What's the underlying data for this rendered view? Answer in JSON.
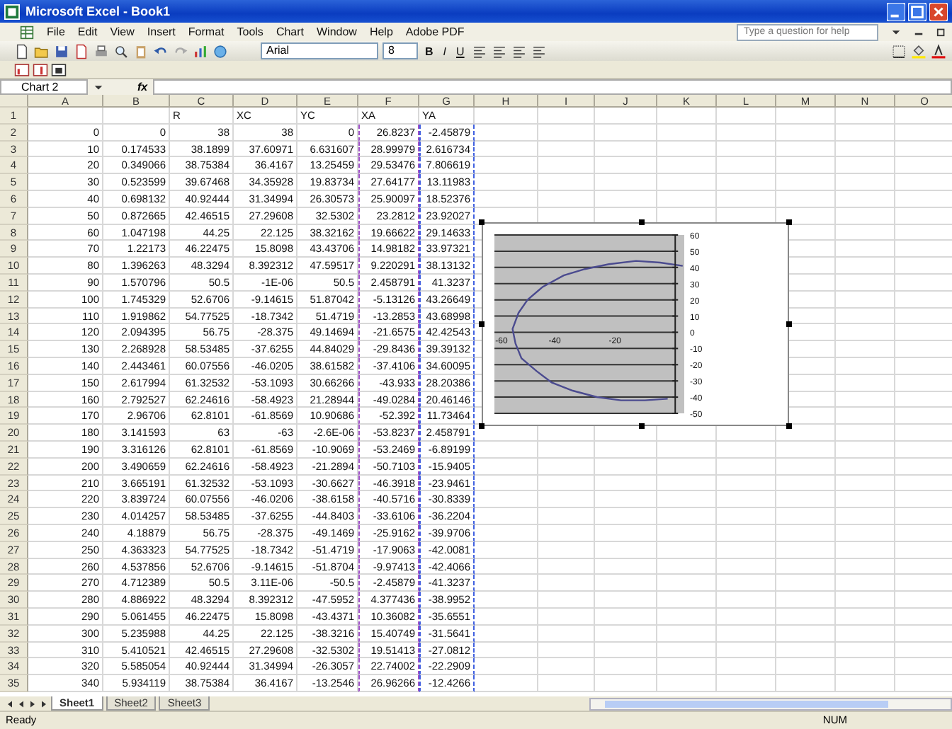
{
  "window": {
    "title": "Microsoft Excel - Book1"
  },
  "menu": [
    "File",
    "Edit",
    "View",
    "Insert",
    "Format",
    "Tools",
    "Chart",
    "Window",
    "Help",
    "Adobe PDF"
  ],
  "help_box": {
    "placeholder": "Type a question for help"
  },
  "format_toolbar": {
    "font": "Arial",
    "size": "8",
    "styles": [
      {
        "label": "B",
        "kind": "bold"
      },
      {
        "label": "I",
        "kind": "italic"
      },
      {
        "label": "U",
        "kind": "underline"
      }
    ]
  },
  "formula_bar": {
    "name_box": "Chart 2",
    "function_label": "fx"
  },
  "columns": [
    "A",
    "B",
    "C",
    "D",
    "E",
    "F",
    "G",
    "H",
    "I",
    "J",
    "K",
    "L",
    "M",
    "N",
    "O"
  ],
  "rows": [
    {
      "number": "1",
      "kind": "labels",
      "cells": [
        null,
        null,
        "R",
        "XC",
        "YC",
        "XA",
        "YA"
      ]
    },
    {
      "number": "2",
      "kind": "values",
      "cells": [
        "0",
        "0",
        "38",
        "38",
        "0",
        "26.8237",
        "-2.45879"
      ]
    },
    {
      "number": "3",
      "kind": "values",
      "cells": [
        "10",
        "0.174533",
        "38.1899",
        "37.60971",
        "6.631607",
        "28.99979",
        "2.616734"
      ]
    },
    {
      "number": "4",
      "kind": "values",
      "cells": [
        "20",
        "0.349066",
        "38.75384",
        "36.4167",
        "13.25459",
        "29.53476",
        "7.806619"
      ]
    },
    {
      "number": "5",
      "kind": "values",
      "cells": [
        "30",
        "0.523599",
        "39.67468",
        "34.35928",
        "19.83734",
        "27.64177",
        "13.11983"
      ]
    },
    {
      "number": "6",
      "kind": "values",
      "cells": [
        "40",
        "0.698132",
        "40.92444",
        "31.34994",
        "26.30573",
        "25.90097",
        "18.52376"
      ]
    },
    {
      "number": "7",
      "kind": "values",
      "cells": [
        "50",
        "0.872665",
        "42.46515",
        "27.29608",
        "32.5302",
        "23.2812",
        "23.92027"
      ]
    },
    {
      "number": "8",
      "kind": "values",
      "cells": [
        "60",
        "1.047198",
        "44.25",
        "22.125",
        "38.32162",
        "19.66622",
        "29.14633"
      ]
    },
    {
      "number": "9",
      "kind": "values",
      "cells": [
        "70",
        "1.22173",
        "46.22475",
        "15.8098",
        "43.43706",
        "14.98182",
        "33.97321"
      ]
    },
    {
      "number": "10",
      "kind": "values",
      "cells": [
        "80",
        "1.396263",
        "48.3294",
        "8.392312",
        "47.59517",
        "9.220291",
        "38.13132"
      ]
    },
    {
      "number": "11",
      "kind": "values",
      "cells": [
        "90",
        "1.570796",
        "50.5",
        "-1E-06",
        "50.5",
        "2.458791",
        "41.3237"
      ]
    },
    {
      "number": "12",
      "kind": "values",
      "cells": [
        "100",
        "1.745329",
        "52.6706",
        "-9.14615",
        "51.87042",
        "-5.13126",
        "43.26649"
      ]
    },
    {
      "number": "13",
      "kind": "values",
      "cells": [
        "110",
        "1.919862",
        "54.77525",
        "-18.7342",
        "51.4719",
        "-13.2853",
        "43.68998"
      ]
    },
    {
      "number": "14",
      "kind": "values",
      "cells": [
        "120",
        "2.094395",
        "56.75",
        "-28.375",
        "49.14694",
        "-21.6575",
        "42.42543"
      ]
    },
    {
      "number": "15",
      "kind": "values",
      "cells": [
        "130",
        "2.268928",
        "58.53485",
        "-37.6255",
        "44.84029",
        "-29.8436",
        "39.39132"
      ]
    },
    {
      "number": "16",
      "kind": "values",
      "cells": [
        "140",
        "2.443461",
        "60.07556",
        "-46.0205",
        "38.61582",
        "-37.4106",
        "34.60095"
      ]
    },
    {
      "number": "17",
      "kind": "values",
      "cells": [
        "150",
        "2.617994",
        "61.32532",
        "-53.1093",
        "30.66266",
        "-43.933",
        "28.20386"
      ]
    },
    {
      "number": "18",
      "kind": "values",
      "cells": [
        "160",
        "2.792527",
        "62.24616",
        "-58.4923",
        "21.28944",
        "-49.0284",
        "20.46146"
      ]
    },
    {
      "number": "19",
      "kind": "values",
      "cells": [
        "170",
        "2.96706",
        "62.8101",
        "-61.8569",
        "10.90686",
        "-52.392",
        "11.73464"
      ]
    },
    {
      "number": "20",
      "kind": "values",
      "cells": [
        "180",
        "3.141593",
        "63",
        "-63",
        "-2.6E-06",
        "-53.8237",
        "2.458791"
      ]
    },
    {
      "number": "21",
      "kind": "values",
      "cells": [
        "190",
        "3.316126",
        "62.8101",
        "-61.8569",
        "-10.9069",
        "-53.2469",
        "-6.89199"
      ]
    },
    {
      "number": "22",
      "kind": "values",
      "cells": [
        "200",
        "3.490659",
        "62.24616",
        "-58.4923",
        "-21.2894",
        "-50.7103",
        "-15.9405"
      ]
    },
    {
      "number": "23",
      "kind": "values",
      "cells": [
        "210",
        "3.665191",
        "61.32532",
        "-53.1093",
        "-30.6627",
        "-46.3918",
        "-23.9461"
      ]
    },
    {
      "number": "24",
      "kind": "values",
      "cells": [
        "220",
        "3.839724",
        "60.07556",
        "-46.0206",
        "-38.6158",
        "-40.5716",
        "-30.8339"
      ]
    },
    {
      "number": "25",
      "kind": "values",
      "cells": [
        "230",
        "4.014257",
        "58.53485",
        "-37.6255",
        "-44.8403",
        "-33.6106",
        "-36.2204"
      ]
    },
    {
      "number": "26",
      "kind": "values",
      "cells": [
        "240",
        "4.18879",
        "56.75",
        "-28.375",
        "-49.1469",
        "-25.9162",
        "-39.9706"
      ]
    },
    {
      "number": "27",
      "kind": "values",
      "cells": [
        "250",
        "4.363323",
        "54.77525",
        "-18.7342",
        "-51.4719",
        "-17.9063",
        "-42.0081"
      ]
    },
    {
      "number": "28",
      "kind": "values",
      "cells": [
        "260",
        "4.537856",
        "52.6706",
        "-9.14615",
        "-51.8704",
        "-9.97413",
        "-42.4066"
      ]
    },
    {
      "number": "29",
      "kind": "values",
      "cells": [
        "270",
        "4.712389",
        "50.5",
        "3.11E-06",
        "-50.5",
        "-2.45879",
        "-41.3237"
      ]
    },
    {
      "number": "30",
      "kind": "values",
      "cells": [
        "280",
        "4.886922",
        "48.3294",
        "8.392312",
        "-47.5952",
        "4.377436",
        "-38.9952"
      ]
    },
    {
      "number": "31",
      "kind": "values",
      "cells": [
        "290",
        "5.061455",
        "46.22475",
        "15.8098",
        "-43.4371",
        "10.36082",
        "-35.6551"
      ]
    },
    {
      "number": "32",
      "kind": "values",
      "cells": [
        "300",
        "5.235988",
        "44.25",
        "22.125",
        "-38.3216",
        "15.40749",
        "-31.5641"
      ]
    },
    {
      "number": "33",
      "kind": "values",
      "cells": [
        "310",
        "5.410521",
        "42.46515",
        "27.29608",
        "-32.5302",
        "19.51413",
        "-27.0812"
      ]
    },
    {
      "number": "34",
      "kind": "values",
      "cells": [
        "320",
        "5.585054",
        "40.92444",
        "31.34994",
        "-26.3057",
        "22.74002",
        "-22.2909"
      ]
    },
    {
      "number": "35",
      "kind": "values",
      "cells": [
        "340",
        "5.934119",
        "38.75384",
        "36.4167",
        "-13.2546",
        "26.96266",
        "-12.4266"
      ]
    }
  ],
  "chart": {
    "chart_data": {
      "type": "line",
      "x": [
        2.5,
        -5,
        -13,
        -22,
        -30,
        -37,
        -44,
        -49,
        -52,
        -54,
        -53,
        -51,
        -46,
        -41,
        -34,
        -26,
        -18,
        -10,
        -2.5
      ],
      "series": [
        {
          "color": "#4b4b8f",
          "values": [
            41,
            43,
            44,
            42,
            39,
            35,
            28,
            20,
            12,
            2,
            -7,
            -16,
            -24,
            -31,
            -36,
            -40,
            -42,
            -42,
            -41
          ]
        }
      ],
      "grid": true,
      "xlim": [
        -60,
        3
      ],
      "ylim": [
        -50,
        60
      ],
      "xticks": [
        -60,
        -40,
        -20
      ],
      "yticks": [
        -50,
        -40,
        -30,
        -20,
        -10,
        0,
        10,
        20,
        30,
        40,
        50,
        60
      ]
    }
  },
  "sheet_tabs": [
    {
      "label": "Sheet1",
      "selected": true
    },
    {
      "label": "Sheet2",
      "selected": false
    },
    {
      "label": "Sheet3",
      "selected": false
    }
  ],
  "status_bar": {
    "mode": "Ready",
    "indicator": "NUM"
  }
}
